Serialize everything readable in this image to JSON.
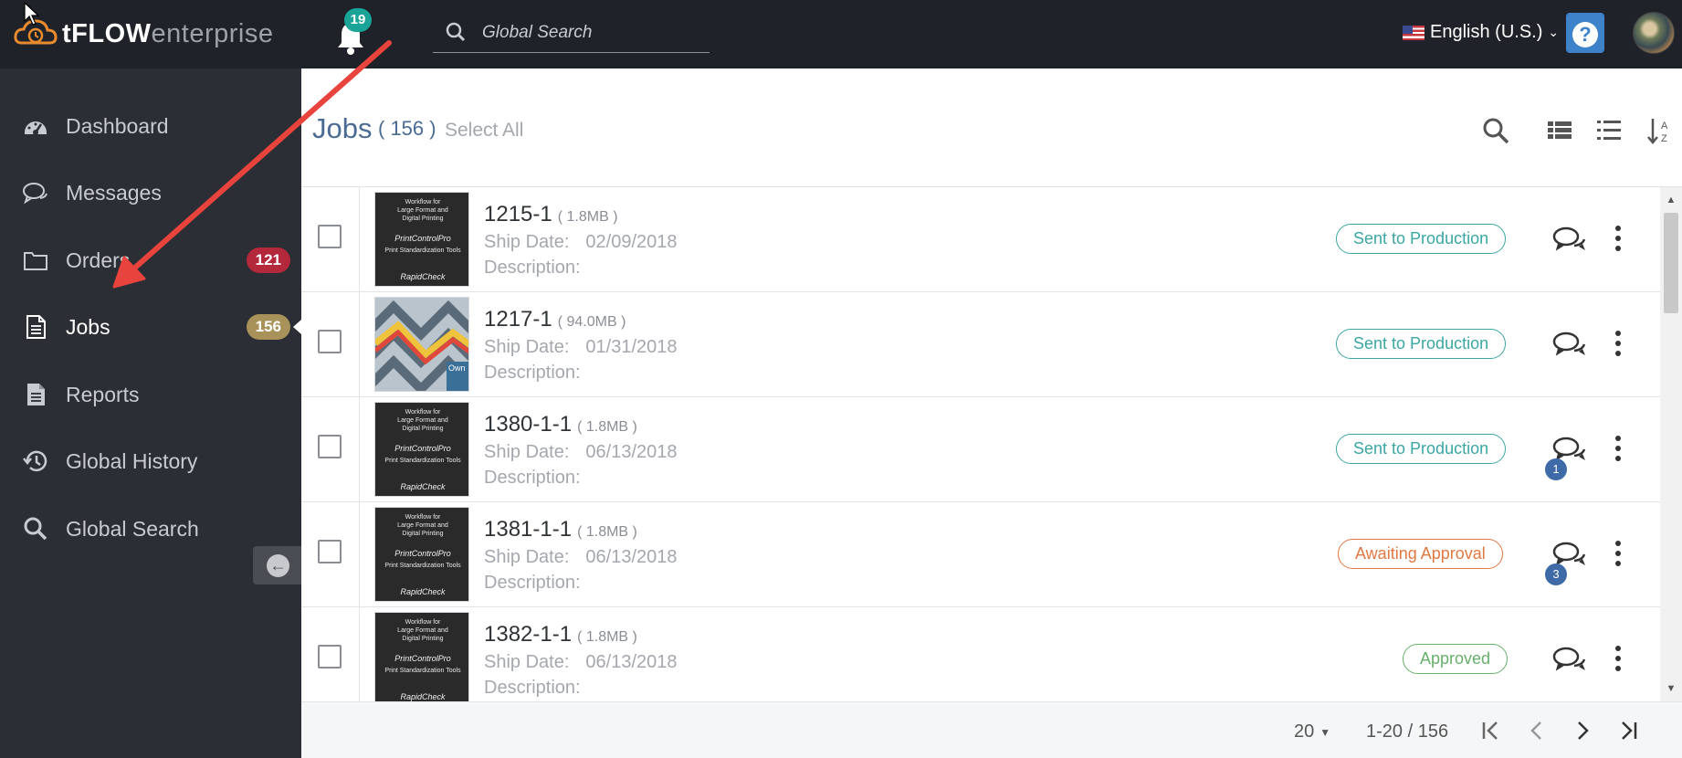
{
  "app": {
    "logo_bold": "tFLOW",
    "logo_light": "enterprise",
    "notifications_count": "19",
    "search_placeholder": "Global Search",
    "language": "English (U.S.)",
    "help_label": "?"
  },
  "sidebar": {
    "items": [
      {
        "label": "Dashboard",
        "icon": "dashboard-icon"
      },
      {
        "label": "Messages",
        "icon": "messages-icon"
      },
      {
        "label": "Orders",
        "icon": "folder-icon",
        "badge": "121"
      },
      {
        "label": "Jobs",
        "icon": "document-icon",
        "badge": "156",
        "active": true
      },
      {
        "label": "Reports",
        "icon": "report-icon"
      },
      {
        "label": "Global History",
        "icon": "history-icon"
      },
      {
        "label": "Global Search",
        "icon": "search-icon"
      }
    ]
  },
  "header": {
    "title": "Jobs",
    "count": "( 156 )",
    "select_all": "Select All"
  },
  "jobs": [
    {
      "id": "1215-1",
      "size": "( 1.8MB )",
      "ship_label": "Ship Date:",
      "ship_date": "02/09/2018",
      "desc_label": "Description:",
      "status": "Sent to Production",
      "status_color": "#3aa7a4",
      "comments": ""
    },
    {
      "id": "1217-1",
      "size": "( 94.0MB )",
      "ship_label": "Ship Date:",
      "ship_date": "01/31/2018",
      "desc_label": "Description:",
      "status": "Sent to Production",
      "status_color": "#3aa7a4",
      "comments": ""
    },
    {
      "id": "1380-1-1",
      "size": "( 1.8MB )",
      "ship_label": "Ship Date:",
      "ship_date": "06/13/2018",
      "desc_label": "Description:",
      "status": "Sent to Production",
      "status_color": "#3aa7a4",
      "comments": "1"
    },
    {
      "id": "1381-1-1",
      "size": "( 1.8MB )",
      "ship_label": "Ship Date:",
      "ship_date": "06/13/2018",
      "desc_label": "Description:",
      "status": "Awaiting Approval",
      "status_color": "#e07842",
      "comments": "3"
    },
    {
      "id": "1382-1-1",
      "size": "( 1.8MB )",
      "ship_label": "Ship Date:",
      "ship_date": "06/13/2018",
      "desc_label": "Description:",
      "status": "Approved",
      "status_color": "#67b06a",
      "comments": ""
    }
  ],
  "thumb_text": {
    "line1": "Workflow for",
    "line2": "Large Format and",
    "line3": "Digital Printing",
    "brand1": "PrintControlPro",
    "tools": "Print Standardization Tools",
    "brand2": "RapidCheck",
    "maze_tag": "Own"
  },
  "pagination": {
    "page_size": "20",
    "range": "1-20 / 156"
  },
  "colors": {
    "topbar": "#1f2228",
    "sidebar": "#2b2e34",
    "accent_blue": "#4a6b93",
    "badge_red": "#b3283b",
    "badge_gold": "#a8925a",
    "notification_teal": "#1aa397",
    "annotation_arrow": "#e8433c"
  }
}
